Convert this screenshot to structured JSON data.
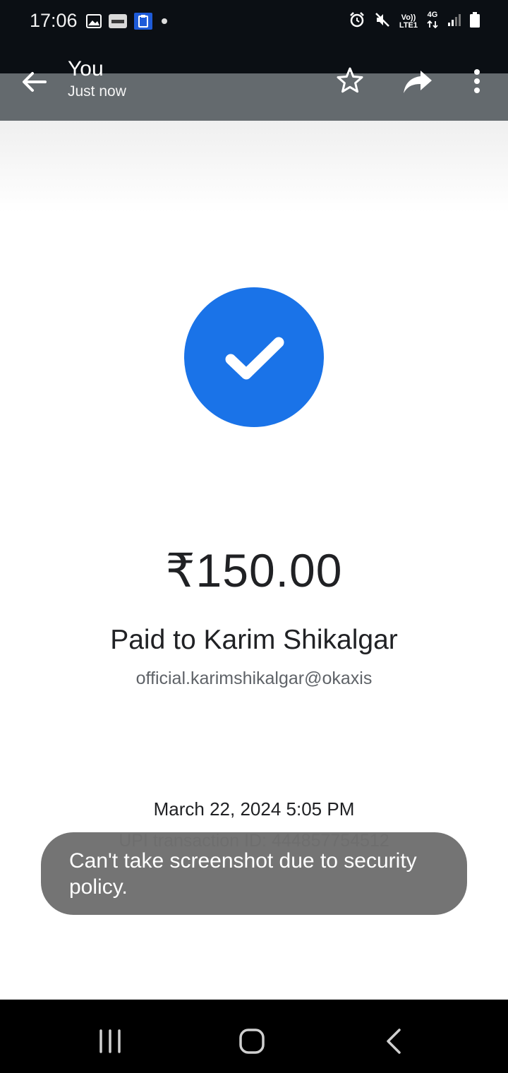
{
  "status_bar": {
    "time": "17:06",
    "left_icons": [
      "gallery-icon",
      "paytm-icon",
      "clipboard-icon",
      "notification-dot-icon"
    ],
    "network_label_top": "Vo))",
    "network_label_bottom": "LTE1",
    "data_label": "4G",
    "right_icons": [
      "alarm-icon",
      "mute-icon",
      "signal-icon",
      "battery-icon"
    ]
  },
  "app_bar": {
    "title": "You",
    "subtitle": "Just now",
    "icons": [
      "back-arrow-icon",
      "star-icon",
      "share-icon",
      "more-vert-icon"
    ]
  },
  "receipt": {
    "amount": "₹150.00",
    "paid_to": "Paid to Karim Shikalgar",
    "upi_id": "official.karimshikalgar@okaxis",
    "datetime": "March 22, 2024 5:05 PM",
    "transaction_id": "UPI transaction ID: 444857754512",
    "status_icon": "check-circle-icon",
    "accent_color": "#1a73e8"
  },
  "toast": {
    "message": "Can't take screenshot due to security policy."
  },
  "nav_bar": {
    "icons": [
      "recent-apps-icon",
      "home-icon",
      "back-icon"
    ]
  }
}
